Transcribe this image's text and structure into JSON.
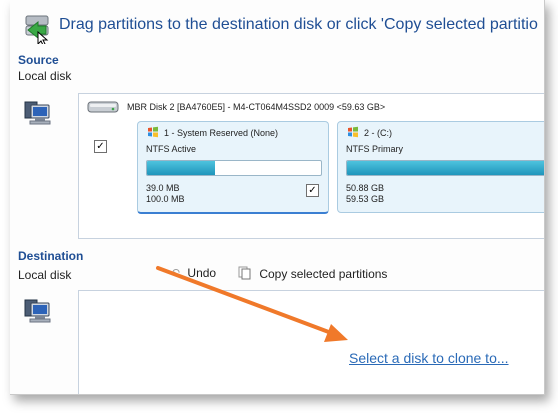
{
  "header": {
    "title": "Drag partitions to the destination disk or click 'Copy selected partitio"
  },
  "source": {
    "title": "Source",
    "subtitle": "Local disk",
    "disk_label": "MBR Disk 2 [BA4760E5] - M4-CT064M4SSD2 0009  <59.63 GB>",
    "disk_checked": true,
    "partitions": [
      {
        "title": "1 - System Reserved (None)",
        "fs": "NTFS Active",
        "used": "39.0 MB",
        "total": "100.0 MB",
        "fill_fraction": 0.39,
        "checked": true
      },
      {
        "title": "2 -  (C:)",
        "fs": "NTFS Primary",
        "used": "50.88 GB",
        "total": "59.53 GB",
        "fill_fraction": 0.85,
        "checked": true
      }
    ]
  },
  "destination": {
    "title": "Destination",
    "subtitle": "Local disk",
    "toolbar": {
      "undo": "Undo",
      "copy": "Copy selected partitions"
    },
    "clone_link": "Select a disk to clone to..."
  },
  "colors": {
    "heading": "#1f4e94",
    "link": "#2a6ab7",
    "arrow": "#f0792a",
    "partition_bg": "#e8f4fb",
    "bar_fill": "#1f95bb"
  }
}
